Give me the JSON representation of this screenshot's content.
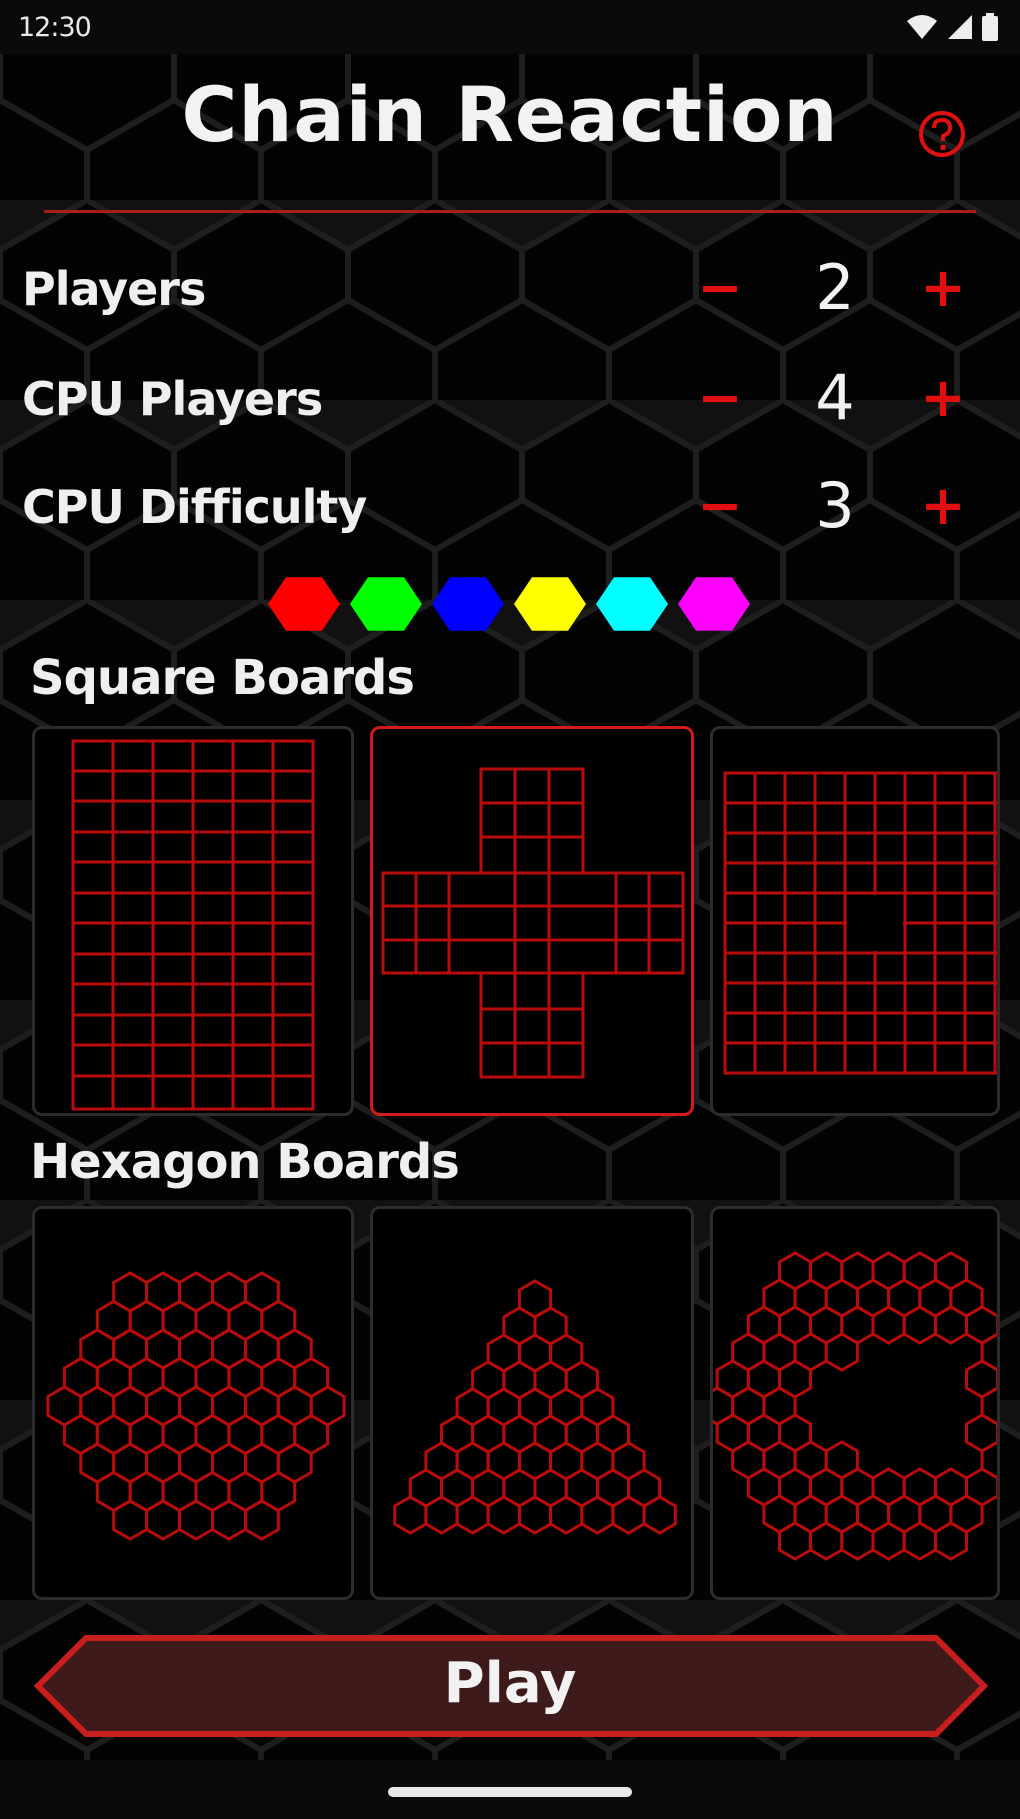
{
  "status_bar": {
    "time": "12:30"
  },
  "app": {
    "title": "Chain Reaction"
  },
  "settings": [
    {
      "label": "Players",
      "value": "2"
    },
    {
      "label": "CPU Players",
      "value": "4"
    },
    {
      "label": "CPU Difficulty",
      "value": "3"
    }
  ],
  "controls": {
    "minus": "−",
    "plus": "+"
  },
  "player_colors": [
    "#ff0000",
    "#00ff00",
    "#0000ff",
    "#ffff00",
    "#00ffff",
    "#ff00ff"
  ],
  "accent_color": "#d41a1a",
  "square_boards": {
    "title": "Square Boards",
    "items": [
      "rectangle-grid",
      "cross-grid",
      "square-with-hole-grid"
    ],
    "selected_index": 1
  },
  "hexagon_boards": {
    "title": "Hexagon Boards",
    "items": [
      "hexagon-hexboard",
      "triangle-hexboard",
      "c-shape-hexboard"
    ]
  },
  "play_button": {
    "label": "Play"
  }
}
